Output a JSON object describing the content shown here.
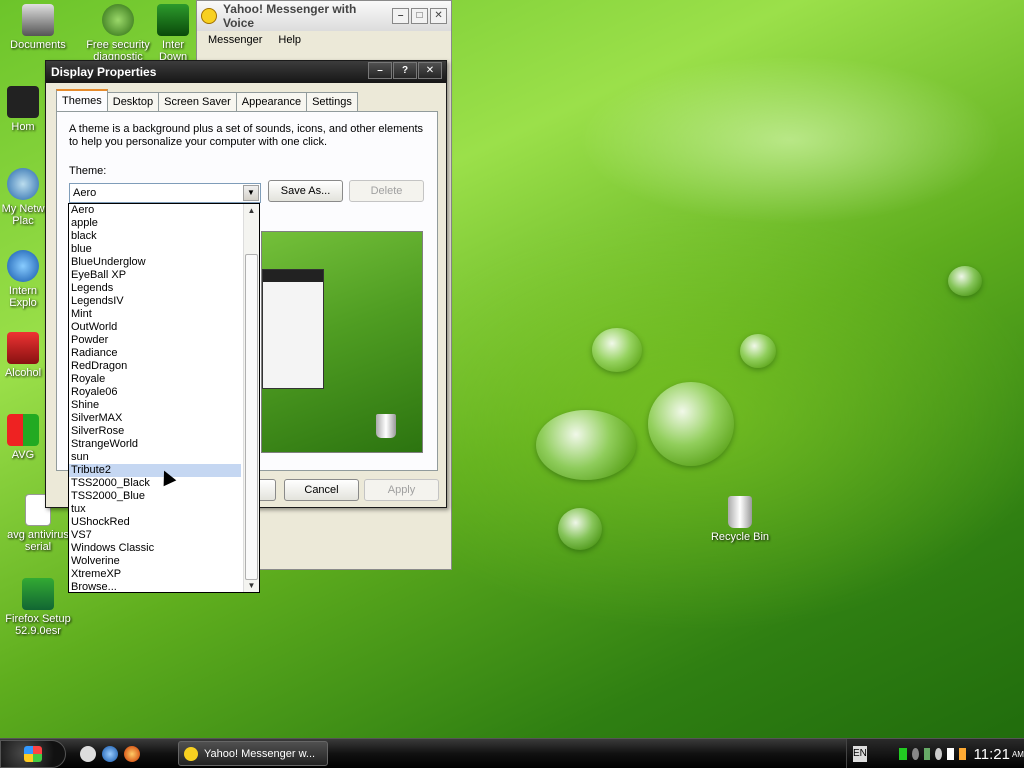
{
  "desktop_icons": [
    {
      "label": "Documents",
      "icon": "documents-folder-icon"
    },
    {
      "label": "Free security diagnostic",
      "icon": "security-globe-icon"
    },
    {
      "label": "Inter Down",
      "icon": "download-icon"
    },
    {
      "label": "Hom",
      "icon": "computer-icon"
    },
    {
      "label": "My Netw Plac",
      "icon": "network-places-icon"
    },
    {
      "label": "Intern Explo",
      "icon": "internet-explorer-icon"
    },
    {
      "label": "Alcohol",
      "icon": "alcohol-icon"
    },
    {
      "label": "AVG",
      "icon": "avg-icon"
    },
    {
      "label": "avg antivirus serial",
      "icon": "text-document-icon"
    },
    {
      "label": "Firefox Setup 52.9.0esr",
      "icon": "firefox-setup-icon"
    },
    {
      "label": "Recycle Bin",
      "icon": "recycle-bin-icon"
    }
  ],
  "yahoo_window": {
    "title": "Yahoo! Messenger with Voice",
    "menu": [
      "Messenger",
      "Help"
    ]
  },
  "display_properties": {
    "title": "Display Properties",
    "tabs": [
      "Themes",
      "Desktop",
      "Screen Saver",
      "Appearance",
      "Settings"
    ],
    "active_tab": "Themes",
    "description": "A theme is a background plus a set of sounds, icons, and other elements to help you personalize your computer with one click.",
    "theme_label": "Theme:",
    "selected_theme": "Aero",
    "save_as": "Save As...",
    "delete": "Delete",
    "cancel": "Cancel",
    "apply": "Apply"
  },
  "theme_list": {
    "items": [
      "Aero",
      "apple",
      "black",
      "blue",
      "BlueUnderglow",
      "EyeBall XP",
      "Legends",
      "LegendsIV",
      "Mint",
      "OutWorld",
      "Powder",
      "Radiance",
      "RedDragon",
      "Royale",
      "Royale06",
      "Shine",
      "SilverMAX",
      "SilverRose",
      "StrangeWorld",
      "sun",
      "Tribute2",
      "TSS2000_Black",
      "TSS2000_Blue",
      "tux",
      "UShockRed",
      "VS7",
      "Windows Classic",
      "Wolverine",
      "XtremeXP",
      "Browse..."
    ],
    "highlighted": "Tribute2"
  },
  "taskbar": {
    "task_label": "Yahoo! Messenger w...",
    "language": "EN",
    "clock": "11:21",
    "clock_ampm": "AM"
  },
  "colors": {
    "accent_tab": "#e68b2c",
    "list_highlight": "#c5d7f2",
    "title_dark": "#161616"
  }
}
